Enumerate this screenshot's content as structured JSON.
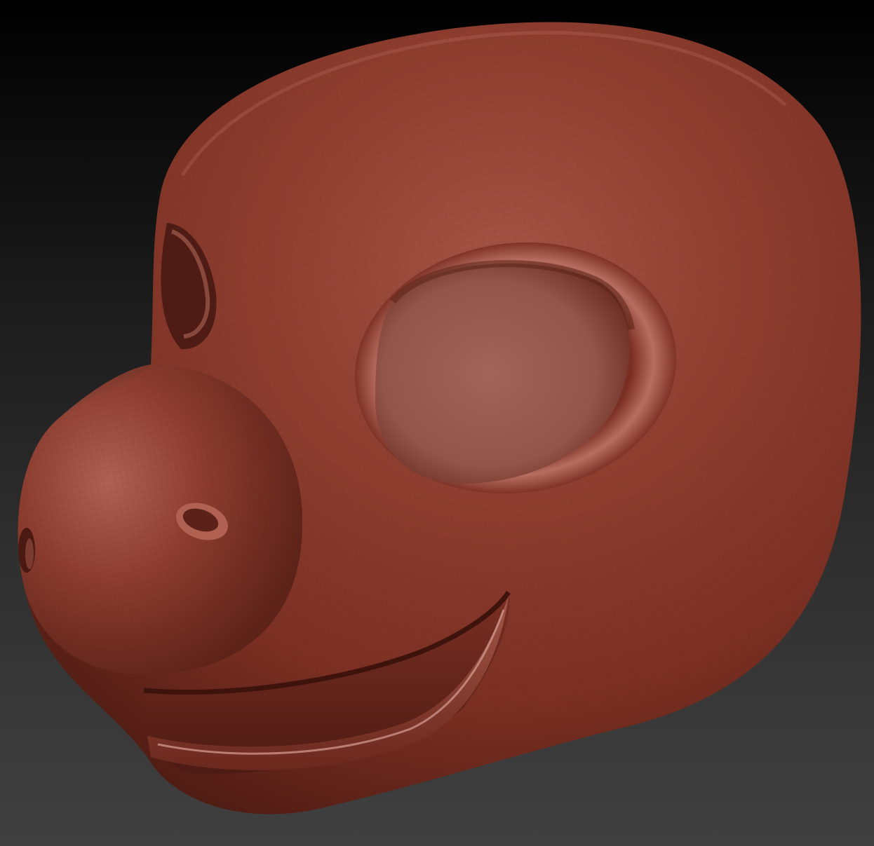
{
  "viewport": {
    "background_top": "#000000",
    "background_bottom": "#404040"
  },
  "model": {
    "material_color": "#8a3a2c",
    "highlight_color": "#b86a5c",
    "shadow_color": "#4a1a12",
    "wireframe_color": "#6e2a1e"
  }
}
